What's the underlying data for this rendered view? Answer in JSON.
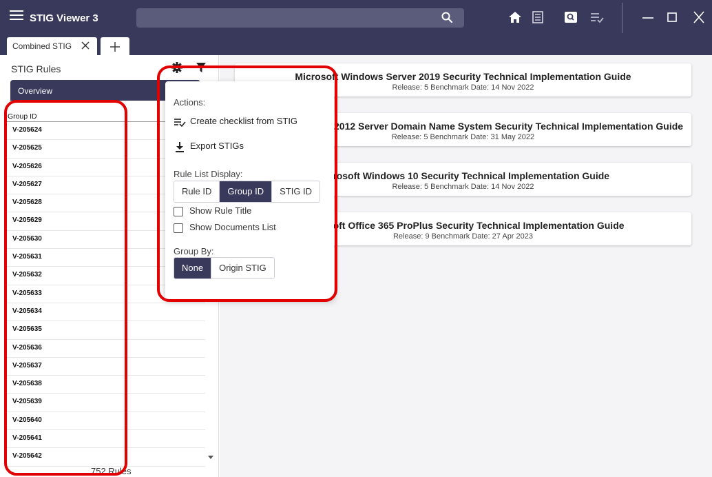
{
  "app": {
    "title": "STIG Viewer 3",
    "search_placeholder": ""
  },
  "tabs": [
    {
      "label": "Combined STIG"
    }
  ],
  "left_panel": {
    "title": "STIG Rules",
    "overview_tab": "Overview",
    "column_header": "Group ID",
    "rules": [
      "V-205624",
      "V-205625",
      "V-205626",
      "V-205627",
      "V-205628",
      "V-205629",
      "V-205630",
      "V-205631",
      "V-205632",
      "V-205633",
      "V-205634",
      "V-205635",
      "V-205636",
      "V-205637",
      "V-205638",
      "V-205639",
      "V-205640",
      "V-205641",
      "V-205642"
    ],
    "rules_count": "752 Rules"
  },
  "popup": {
    "actions_label": "Actions:",
    "create_checklist": "Create checklist from STIG",
    "export_stigs": "Export STIGs",
    "rule_list_display_label": "Rule List Display:",
    "display_options": [
      "Rule ID",
      "Group ID",
      "STIG ID"
    ],
    "display_selected": "Group ID",
    "show_rule_title": "Show Rule Title",
    "show_documents_list": "Show Documents List",
    "group_by_label": "Group By:",
    "group_by_options": [
      "None",
      "Origin STIG"
    ],
    "group_by_selected": "None"
  },
  "stig_cards": [
    {
      "title": "Microsoft Windows Server 2019 Security Technical Implementation Guide",
      "subtitle": "Release: 5 Benchmark Date: 14 Nov 2022"
    },
    {
      "title": "Microsoft Windows 2012 Server Domain Name System Security Technical Implementation Guide",
      "subtitle": "Release: 5 Benchmark Date: 31 May 2022"
    },
    {
      "title": "Microsoft Windows 10 Security Technical Implementation Guide",
      "subtitle": "Release: 5 Benchmark Date: 14 Nov 2022"
    },
    {
      "title": "Microsoft Office 365 ProPlus Security Technical Implementation Guide",
      "subtitle": "Release: 9 Benchmark Date: 27 Apr 2023"
    }
  ],
  "icons": {
    "menu": "hamburger-menu-icon",
    "search": "search-icon",
    "home": "home-icon",
    "document": "document-list-icon",
    "lookup": "search-box-icon",
    "checklist": "checklist-icon",
    "minimize": "minimize-icon",
    "maximize": "maximize-icon",
    "close": "close-icon",
    "settings": "gear-icon",
    "filter": "filter-icon",
    "export": "download-icon"
  },
  "colors": {
    "titlebar": "#39395c",
    "accent": "#39395c",
    "annotation": "#e30000",
    "panel_bg": "#f4f4f6"
  }
}
